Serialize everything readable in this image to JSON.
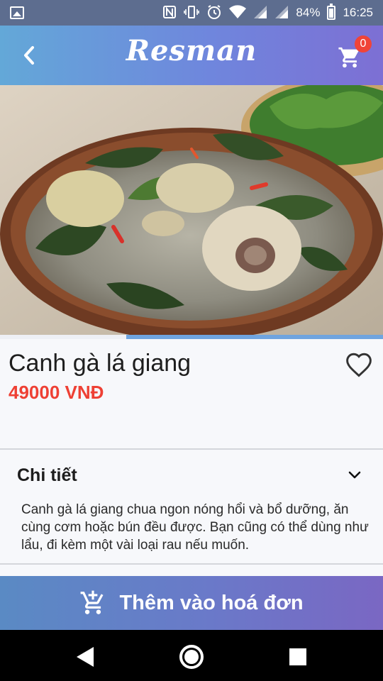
{
  "status_bar": {
    "battery": "84%",
    "time": "16:25",
    "battery_level": 0.84,
    "icons": [
      "gallery-icon",
      "nfc-icon",
      "vibrate-icon",
      "alarm-icon",
      "wifi-icon",
      "signal-icon",
      "signal-icon",
      "battery-icon"
    ]
  },
  "app_bar": {
    "brand": "Resman",
    "cart_count": "0",
    "back_icon": "back-arrow-icon",
    "cart_icon": "cart-icon"
  },
  "product": {
    "name": "Canh gà lá giang",
    "price": "49000 VNĐ",
    "image_progress": 0.67,
    "favorite_icon": "heart-outline-icon"
  },
  "details": {
    "title": "Chi tiết",
    "expand_icon": "chevron-down-icon",
    "body": "Canh gà lá giang chua ngon nóng hổi và bổ dưỡng, ăn cùng cơm hoặc bún đều được. Bạn cũng có thể dùng như lẩu, đi kèm một vài loại rau nếu muốn."
  },
  "action": {
    "label": "Thêm vào hoá đơn",
    "icon": "add-to-cart-icon"
  },
  "nav": {
    "icons": [
      "back-triangle-icon",
      "home-circle-icon",
      "recents-square-icon"
    ]
  },
  "colors": {
    "price": "#ee4034",
    "badge": "#f04438",
    "accent": "#6fa4df"
  }
}
